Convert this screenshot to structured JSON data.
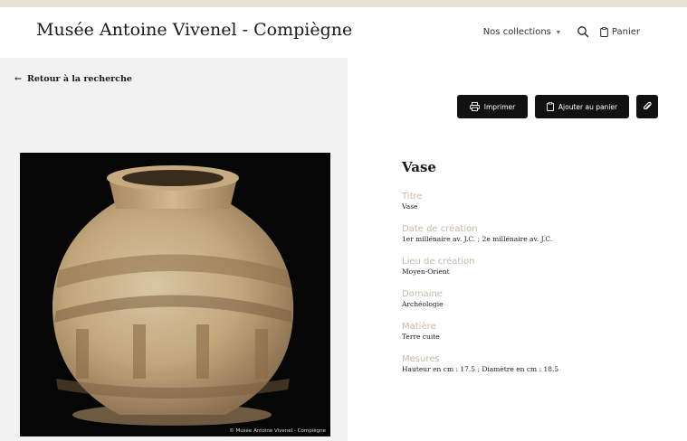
{
  "header": {
    "site_title": "Musée Antoine Vivenel - Compiègne",
    "nav": {
      "collections_label": "Nos collections",
      "cart_label": "Panier"
    }
  },
  "back_link": {
    "label": "Retour à la recherche"
  },
  "photo": {
    "credit": "© Musée Antoine Vivenel - Compiègne"
  },
  "actions": {
    "print_label": "Imprimer",
    "add_to_cart_label": "Ajouter au panier"
  },
  "object": {
    "title": "Vase",
    "fields": [
      {
        "label": "Titre",
        "value": "Vase"
      },
      {
        "label": "Date de création",
        "value": "1er millénaire av. J.C. ; 2e millénaire av. J.C."
      },
      {
        "label": "Lieu de création",
        "value": "Moyen-Orient"
      },
      {
        "label": "Domaine",
        "value": "Archéologie"
      },
      {
        "label": "Matière",
        "value": "Terre cuite"
      },
      {
        "label": "Mesures",
        "value": "Hauteur en cm : 17.5 ; Diamètre en cm : 18.5"
      }
    ]
  },
  "colors": {
    "accent_label": "#c7b9a7",
    "button_bg": "#111111",
    "top_strip": "#e8e2d6",
    "left_panel": "#f2f2f2"
  }
}
